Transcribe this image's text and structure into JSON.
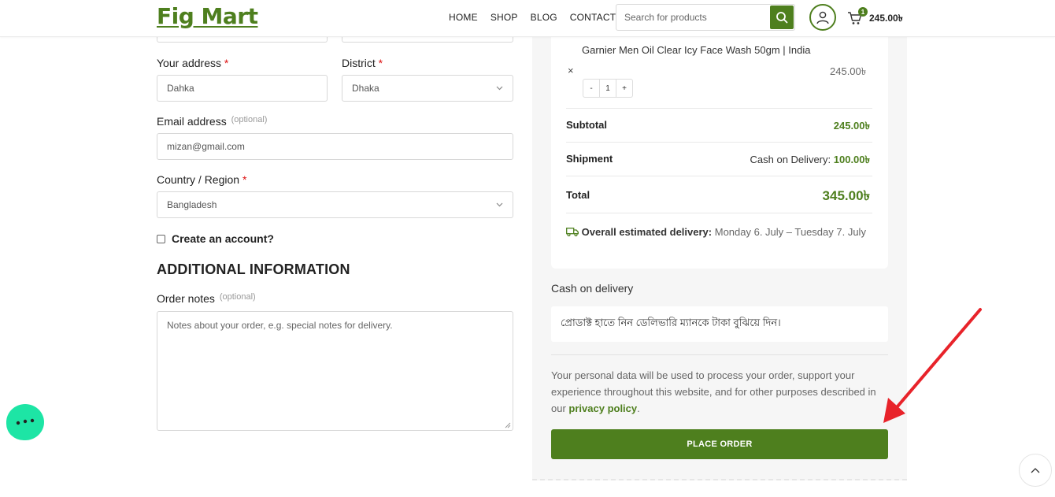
{
  "header": {
    "logo": "Fig Mart",
    "nav": [
      "HOME",
      "SHOP",
      "BLOG",
      "CONTACT"
    ],
    "search_placeholder": "Search for products",
    "cart_count": "1",
    "cart_total": "245.00৳"
  },
  "form": {
    "address_label": "Your address",
    "address_value": "Dahka",
    "district_label": "District",
    "district_value": "Dhaka",
    "email_label": "Email address",
    "email_optional": "(optional)",
    "email_value": "mizan@gmail.com",
    "country_label": "Country / Region",
    "country_value": "Bangladesh",
    "create_account_label": "Create an account?",
    "additional_title": "ADDITIONAL INFORMATION",
    "notes_label": "Order notes",
    "notes_optional": "(optional)",
    "notes_placeholder": "Notes about your order, e.g. special notes for delivery.",
    "required_mark": "*"
  },
  "order": {
    "product_name": "Garnier Men Oil Clear Icy Face Wash 50gm | India",
    "remove_symbol": "×",
    "qty_minus": "-",
    "qty_value": "1",
    "qty_plus": "+",
    "product_price": "245.00৳",
    "subtotal_label": "Subtotal",
    "subtotal_value": "245.00৳",
    "shipment_label": "Shipment",
    "shipment_method": "Cash on Delivery:",
    "shipment_value": "100.00৳",
    "total_label": "Total",
    "total_value": "345.00৳",
    "delivery_label": "Overall estimated delivery:",
    "delivery_value": "Monday 6. July – Tuesday 7. July"
  },
  "payment": {
    "method_title": "Cash on delivery",
    "method_note": "প্রোডাক্ট হাতে নিন ডেলিভারি ম্যানকে টাকা বুঝিয়ে দিন।",
    "privacy_text": "Your personal data will be used to process your order, support your experience throughout this website, and for other purposes described in our",
    "privacy_link": "privacy policy",
    "privacy_end": ".",
    "place_order_label": "PLACE ORDER"
  },
  "colors": {
    "brand_green": "#4e7f1e",
    "chat_bubble": "#1de5a5",
    "annotation_arrow": "#e8232a"
  },
  "icons": [
    "search-icon",
    "user-icon",
    "cart-icon",
    "chevron-down-icon",
    "truck-icon",
    "chat-icon",
    "chevron-up-icon"
  ]
}
